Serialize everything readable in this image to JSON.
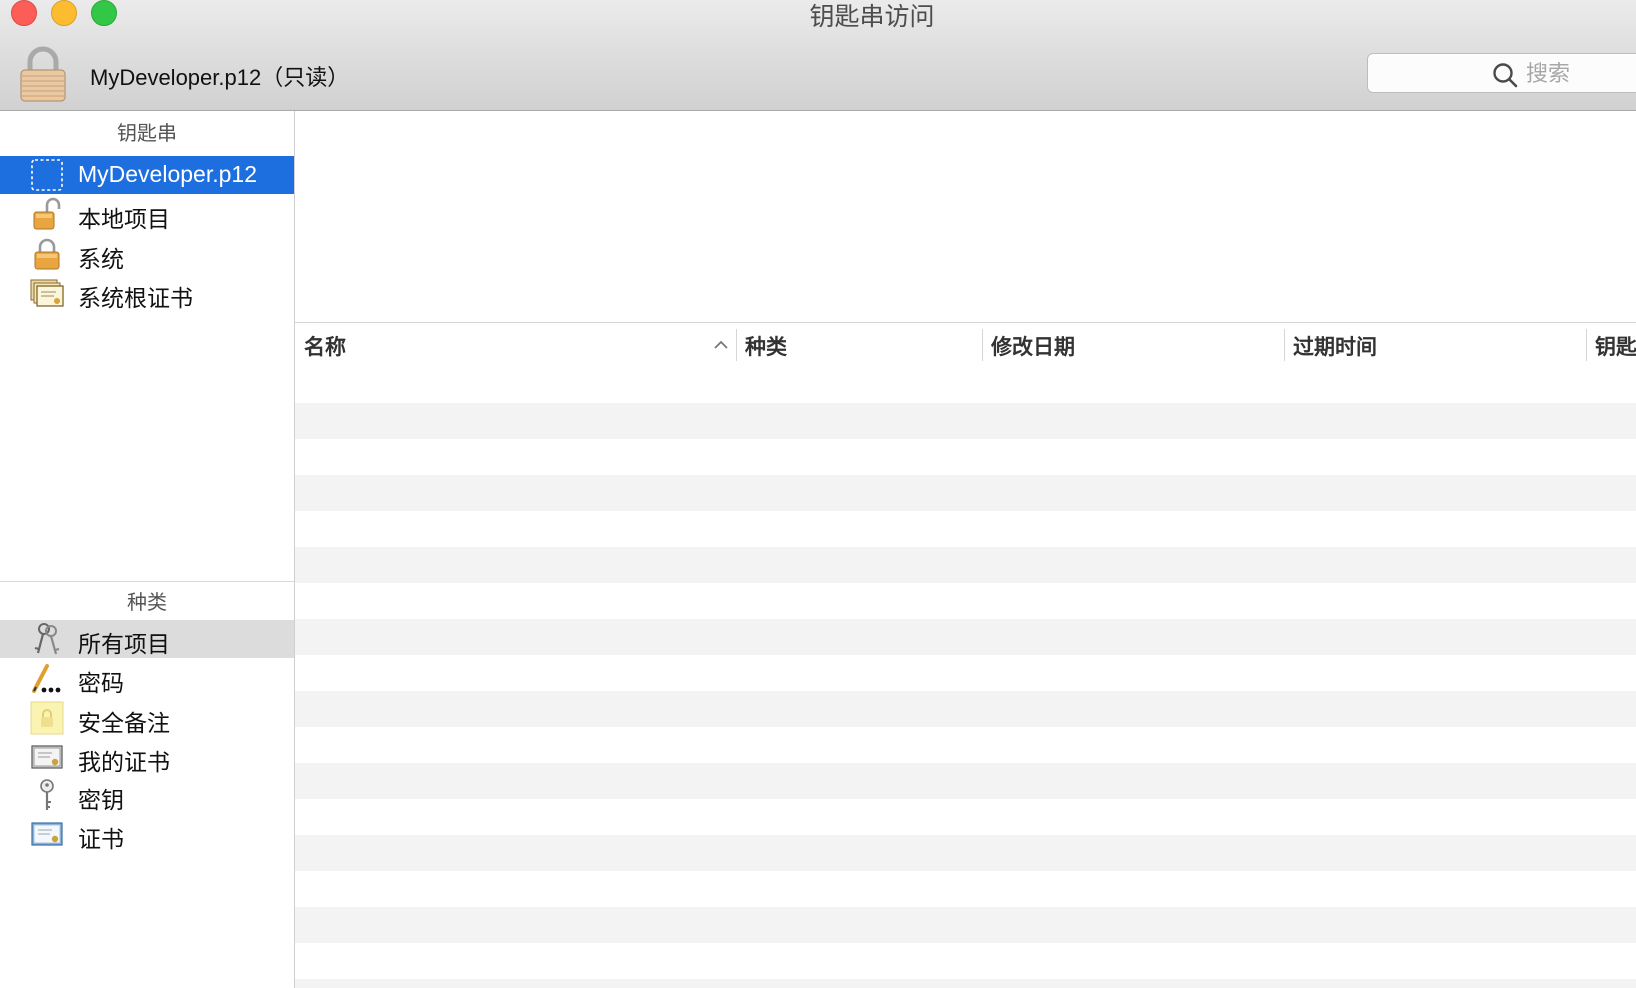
{
  "window": {
    "title": "钥匙串访问",
    "keychain_title": "MyDeveloper.p12（只读）"
  },
  "search": {
    "placeholder": "搜索",
    "value": ""
  },
  "sidebar": {
    "keychains_header": "钥匙串",
    "keychains": [
      {
        "label": "MyDeveloper.p12",
        "icon": "dashed-keychain-icon",
        "selected": true
      },
      {
        "label": "本地项目",
        "icon": "unlocked-padlock-icon"
      },
      {
        "label": "系统",
        "icon": "padlock-icon"
      },
      {
        "label": "系统根证书",
        "icon": "certificate-stack-icon"
      }
    ],
    "category_header": "种类",
    "categories": [
      {
        "label": "所有项目",
        "icon": "keys-icon",
        "selected": true
      },
      {
        "label": "密码",
        "icon": "pencil-dots-icon"
      },
      {
        "label": "安全备注",
        "icon": "secure-note-icon"
      },
      {
        "label": "我的证书",
        "icon": "my-certificate-icon"
      },
      {
        "label": "密钥",
        "icon": "key-icon"
      },
      {
        "label": "证书",
        "icon": "certificate-icon"
      }
    ]
  },
  "table": {
    "columns": [
      {
        "label": "名称",
        "sort": "ascending"
      },
      {
        "label": "种类"
      },
      {
        "label": "修改日期"
      },
      {
        "label": "过期时间"
      },
      {
        "label": "钥匙串"
      }
    ],
    "rows": []
  },
  "colors": {
    "selection_blue": "#1d6fe0",
    "category_selection_gray": "#dcdcdc",
    "close": "#fc5d56",
    "minimize": "#fdbc2f",
    "zoom": "#33c748"
  }
}
